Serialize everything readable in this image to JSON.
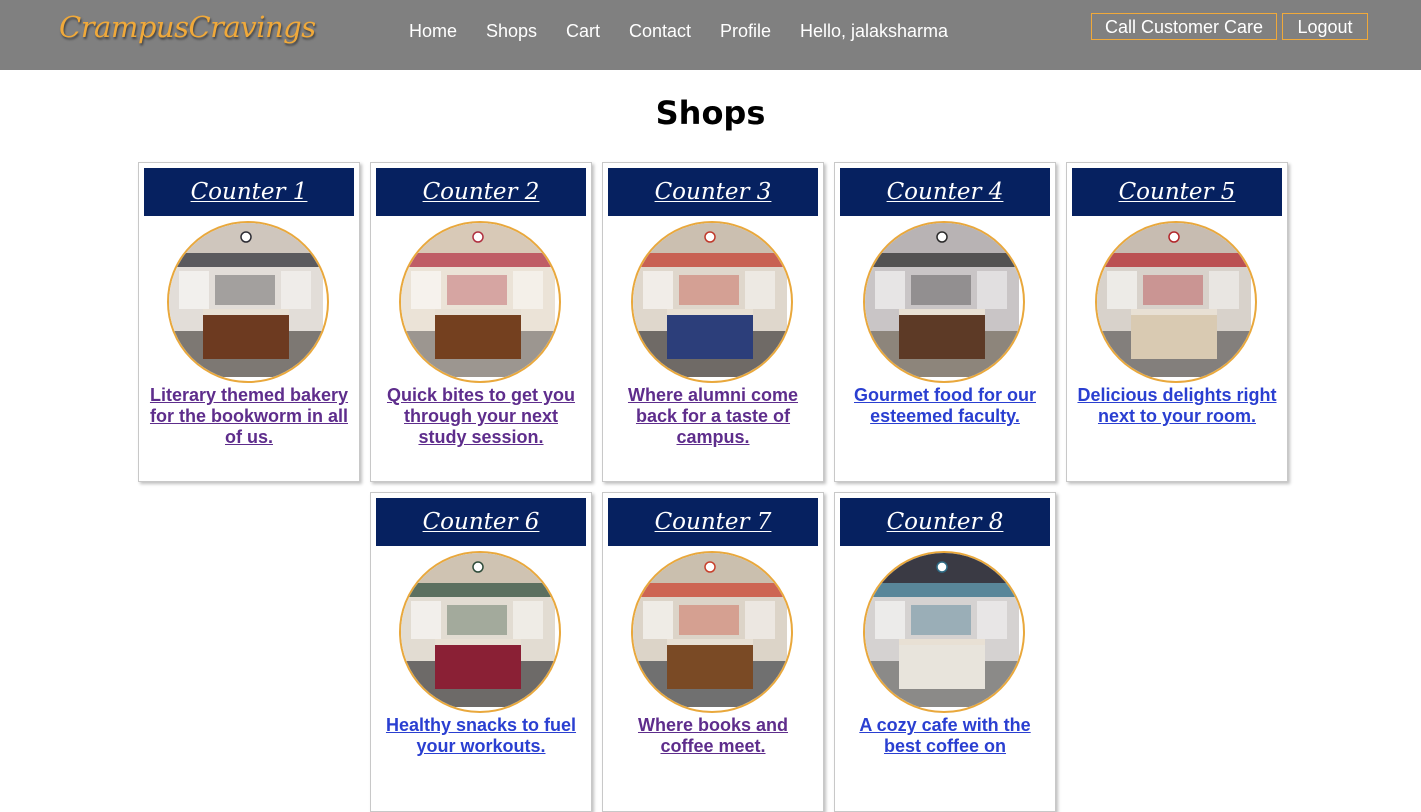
{
  "brand": "CrampusCravings",
  "nav": {
    "home": "Home",
    "shops": "Shops",
    "cart": "Cart",
    "contact": "Contact",
    "profile": "Profile",
    "greeting": "Hello, jalaksharma",
    "call_customer_care": "Call Customer Care",
    "logout": "Logout"
  },
  "colors": {
    "navbar": "#808080",
    "brand": "#f0a93a",
    "card_header": "#062160",
    "visited_link": "#5e2d8c",
    "unvisited_link": "#2a3fd1"
  },
  "page_title": "Shops",
  "shops": [
    {
      "name": "Counter 1",
      "description": "Literary themed bakery for the bookworm in all of us.",
      "link_state": "visited"
    },
    {
      "name": "Counter 2",
      "description": "Quick bites to get you through your next study session.",
      "link_state": "visited"
    },
    {
      "name": "Counter 3",
      "description": "Where alumni come back for a taste of campus.",
      "link_state": "visited"
    },
    {
      "name": "Counter 4",
      "description": "Gourmet food for our esteemed faculty.",
      "link_state": "unvisited"
    },
    {
      "name": "Counter 5",
      "description": "Delicious delights right next to your room.",
      "link_state": "unvisited"
    },
    {
      "name": "Counter 6",
      "description": "Healthy snacks to fuel your workouts.",
      "link_state": "unvisited"
    },
    {
      "name": "Counter 7",
      "description": "Where books and coffee meet.",
      "link_state": "visited"
    },
    {
      "name": "Counter 8",
      "description": "A cozy cafe with the best coffee on",
      "link_state": "unvisited"
    }
  ]
}
